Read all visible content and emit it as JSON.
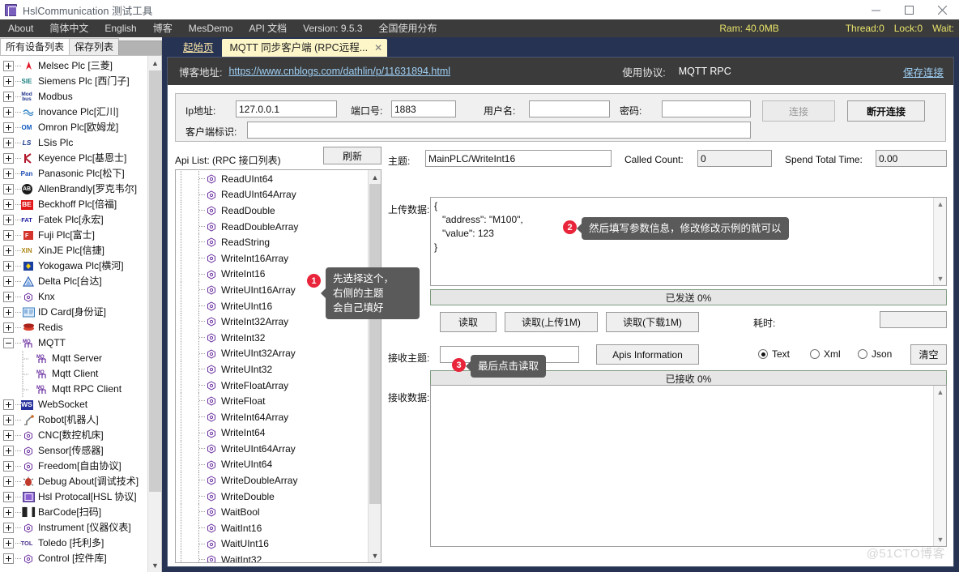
{
  "window": {
    "title": "HslCommunication 测试工具",
    "minimize": "—",
    "maximize": "▢",
    "close": "✕"
  },
  "menu": {
    "items": [
      {
        "label": "About"
      },
      {
        "label": "简体中文"
      },
      {
        "label": "English"
      },
      {
        "label": "博客"
      },
      {
        "label": "MesDemo"
      },
      {
        "label": "API 文档"
      },
      {
        "label": "Version: 9.5.3"
      },
      {
        "label": "全国使用分布"
      }
    ],
    "status": {
      "ram": "Ram: 40.0MB",
      "thread": "Thread:0",
      "lock": "Lock:0",
      "wait": "Wait:"
    }
  },
  "left_tabs": [
    {
      "label": "所有设备列表",
      "selected": true
    },
    {
      "label": "保存列表",
      "selected": false
    }
  ],
  "tree": {
    "items": [
      {
        "label": "Melsec Plc [三菱]",
        "icon": "melsec-icon",
        "level": 0,
        "expander": "plus"
      },
      {
        "label": "Siemens Plc [西门子]",
        "icon": "siemens-icon",
        "level": 0,
        "expander": "plus"
      },
      {
        "label": "Modbus",
        "icon": "modbus-icon",
        "level": 0,
        "expander": "plus"
      },
      {
        "label": "Inovance Plc[汇川]",
        "icon": "inovance-icon",
        "level": 0,
        "expander": "plus"
      },
      {
        "label": "Omron Plc[欧姆龙]",
        "icon": "omron-icon",
        "level": 0,
        "expander": "plus"
      },
      {
        "label": "LSis Plc",
        "icon": "lsis-icon",
        "level": 0,
        "expander": "plus"
      },
      {
        "label": "Keyence Plc[基恩士]",
        "icon": "keyence-icon",
        "level": 0,
        "expander": "plus"
      },
      {
        "label": "Panasonic Plc[松下]",
        "icon": "panasonic-icon",
        "level": 0,
        "expander": "plus"
      },
      {
        "label": "AllenBrandly[罗克韦尔]",
        "icon": "allenbradley-icon",
        "level": 0,
        "expander": "plus"
      },
      {
        "label": "Beckhoff Plc[倍福]",
        "icon": "beckhoff-icon",
        "level": 0,
        "expander": "plus"
      },
      {
        "label": "Fatek Plc[永宏]",
        "icon": "fatek-icon",
        "level": 0,
        "expander": "plus"
      },
      {
        "label": "Fuji Plc[富士]",
        "icon": "fuji-icon",
        "level": 0,
        "expander": "plus"
      },
      {
        "label": "XinJE Plc[信捷]",
        "icon": "xinje-icon",
        "level": 0,
        "expander": "plus"
      },
      {
        "label": "Yokogawa Plc[横河]",
        "icon": "yokogawa-icon",
        "level": 0,
        "expander": "plus"
      },
      {
        "label": "Delta Plc[台达]",
        "icon": "delta-icon",
        "level": 0,
        "expander": "plus"
      },
      {
        "label": "Knx",
        "icon": "knx-icon",
        "level": 0,
        "expander": "plus"
      },
      {
        "label": "ID Card[身份证]",
        "icon": "idcard-icon",
        "level": 0,
        "expander": "plus"
      },
      {
        "label": "Redis",
        "icon": "redis-icon",
        "level": 0,
        "expander": "plus"
      },
      {
        "label": "MQTT",
        "icon": "mqtt-icon",
        "level": 0,
        "expander": "minus"
      },
      {
        "label": "Mqtt Server",
        "icon": "mqtt-icon",
        "level": 1,
        "expander": "none"
      },
      {
        "label": "Mqtt Client",
        "icon": "mqtt-icon",
        "level": 1,
        "expander": "none"
      },
      {
        "label": "Mqtt RPC Client",
        "icon": "mqtt-icon",
        "level": 1,
        "expander": "none"
      },
      {
        "label": "WebSocket",
        "icon": "websocket-icon",
        "level": 0,
        "expander": "plus"
      },
      {
        "label": "Robot[机器人]",
        "icon": "robot-icon",
        "level": 0,
        "expander": "plus"
      },
      {
        "label": "CNC[数控机床]",
        "icon": "cnc-icon",
        "level": 0,
        "expander": "plus"
      },
      {
        "label": "Sensor[传感器]",
        "icon": "sensor-icon",
        "level": 0,
        "expander": "plus"
      },
      {
        "label": "Freedom[自由协议]",
        "icon": "freedom-icon",
        "level": 0,
        "expander": "plus"
      },
      {
        "label": "Debug About[调试技术]",
        "icon": "debug-icon",
        "level": 0,
        "expander": "plus"
      },
      {
        "label": "Hsl Protocal[HSL 协议]",
        "icon": "hsl-icon",
        "level": 0,
        "expander": "plus"
      },
      {
        "label": "BarCode[扫码]",
        "icon": "barcode-icon",
        "level": 0,
        "expander": "plus"
      },
      {
        "label": "Instrument [仪器仪表]",
        "icon": "instrument-icon",
        "level": 0,
        "expander": "plus"
      },
      {
        "label": "Toledo [托利多]",
        "icon": "toledo-icon",
        "level": 0,
        "expander": "plus"
      },
      {
        "label": "Control [控件库]",
        "icon": "control-icon",
        "level": 0,
        "expander": "plus"
      }
    ]
  },
  "main_tabs": [
    {
      "label": "起始页",
      "active": false
    },
    {
      "label": "MQTT 同步客户端 (RPC远程...",
      "active": true,
      "close": "✕"
    }
  ],
  "urlbar": {
    "blog_label": "博客地址:",
    "blog_url": "https://www.cnblogs.com/dathlin/p/11631894.html",
    "protocol_label": "使用协议:",
    "protocol_value": "MQTT RPC",
    "save_link": "保存连接"
  },
  "connection": {
    "ip_label": "Ip地址:",
    "ip_value": "127.0.0.1",
    "port_label": "端口号:",
    "port_value": "1883",
    "user_label": "用户名:",
    "user_value": "",
    "pwd_label": "密码:",
    "pwd_value": "",
    "client_label": "客户端标识:",
    "client_value": "",
    "connect_btn": "连接",
    "disconnect_btn": "断开连接"
  },
  "api_panel": {
    "header": "Api List: (RPC 接口列表)",
    "refresh": "刷新",
    "items": [
      "ReadUInt64",
      "ReadUInt64Array",
      "ReadDouble",
      "ReadDoubleArray",
      "ReadString",
      "WriteInt16Array",
      "WriteInt16",
      "WriteUInt16Array",
      "WriteUInt16",
      "WriteInt32Array",
      "WriteInt32",
      "WriteUInt32Array",
      "WriteUInt32",
      "WriteFloatArray",
      "WriteFloat",
      "WriteInt64Array",
      "WriteInt64",
      "WriteUInt64Array",
      "WriteUInt64",
      "WriteDoubleArray",
      "WriteDouble",
      "WaitBool",
      "WaitInt16",
      "WaitUInt16",
      "WaitInt32"
    ]
  },
  "rpc": {
    "topic_label": "主题:",
    "topic_value": "MainPLC/WriteInt16",
    "called_count_label": "Called Count:",
    "called_count_value": "0",
    "spend_total_label": "Spend Total Time:",
    "spend_total_value": "0.00",
    "upload_label": "上传数据:",
    "upload_value": "{\n   \"address\": \"M100\",\n   \"value\": 123\n}",
    "sent_progress": "已发送 0%",
    "read_btn": "读取",
    "read_upload_btn": "读取(上传1M)",
    "read_download_btn": "读取(下载1M)",
    "elapsed_label": "耗时:",
    "elapsed_value": "",
    "recv_topic_label": "接收主题:",
    "recv_topic_value": "",
    "apis_info_btn": "Apis Information",
    "radio_text": "Text",
    "radio_xml": "Xml",
    "radio_json": "Json",
    "radio_selected": "Text",
    "clear_btn": "清空",
    "recv_progress": "已接收 0%",
    "recv_label": "接收数据:",
    "recv_value": ""
  },
  "callouts": [
    {
      "badge": "1",
      "text": "先选择这个，\n右侧的主题\n会自己填好"
    },
    {
      "badge": "2",
      "text": "然后填写参数信息，修改修改示例的就可以"
    },
    {
      "badge": "3",
      "text": "最后点击读取"
    }
  ],
  "watermark": "@51CTO博客",
  "colors": {
    "menubar_bg": "#3b3b3b",
    "status_text": "#e8e36a",
    "tab_active_bg": "#fdf6c8",
    "right_bg": "#273353",
    "link": "#9fd0f5",
    "badge": "#e8253a",
    "callout_bg": "#5a5a5a"
  }
}
